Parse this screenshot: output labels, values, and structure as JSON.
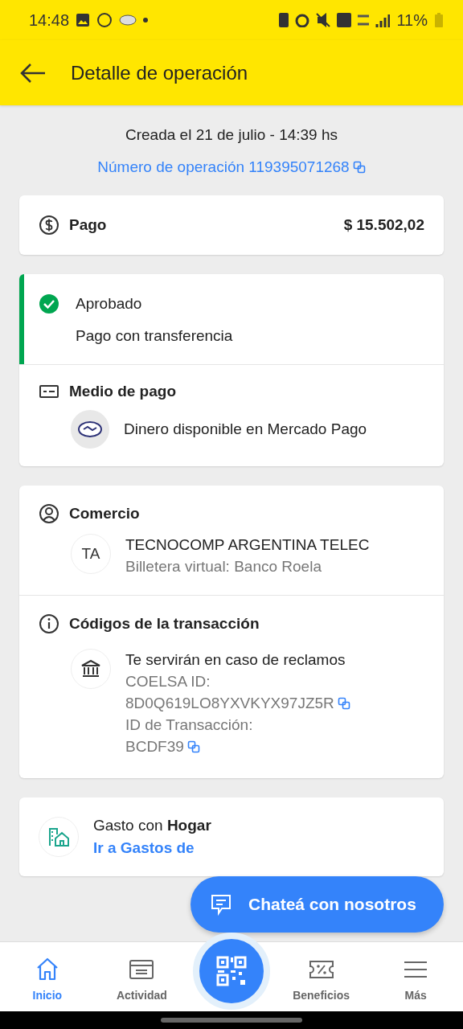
{
  "status_bar": {
    "time": "14:48",
    "battery": "11%"
  },
  "app_bar": {
    "title": "Detalle de operación"
  },
  "header": {
    "created": "Creada el 21 de julio - 14:39 hs",
    "operation_link": "Número de operación 119395071268"
  },
  "payment": {
    "label": "Pago",
    "amount": "$ 15.502,02"
  },
  "status": {
    "approved": true,
    "title": "Aprobado",
    "subtitle": "Pago con transferencia"
  },
  "payment_method": {
    "title": "Medio de pago",
    "value": "Dinero disponible en Mercado Pago"
  },
  "merchant": {
    "title": "Comercio",
    "initials": "TA",
    "name": "TECNOCOMP ARGENTINA TELEC",
    "detail": "Billetera virtual: Banco Roela"
  },
  "codes": {
    "title": "Códigos de la transacción",
    "lines": [
      {
        "kind": "note",
        "text": "Te servirán en caso de reclamos"
      },
      {
        "kind": "label",
        "text": "COELSA ID:"
      },
      {
        "kind": "copyable",
        "text": "8D0Q619LO8YXVKYX97JZ5R"
      },
      {
        "kind": "label",
        "text": "ID de Transacción:"
      },
      {
        "kind": "copyable",
        "text": "BCDF39"
      }
    ]
  },
  "expense": {
    "text": "Gasto con **Hogar**",
    "link": "Ir a Gastos de"
  },
  "chat_button": "Chateá con nosotros",
  "nav": [
    {
      "kind": "tab",
      "label": "Inicio",
      "selected": true
    },
    {
      "kind": "tab",
      "label": "Actividad",
      "selected": false
    },
    {
      "kind": "scan",
      "selected": false
    },
    {
      "kind": "tab",
      "label": "Beneficios",
      "selected": false
    },
    {
      "kind": "tab",
      "label": "Más",
      "selected": false
    }
  ]
}
